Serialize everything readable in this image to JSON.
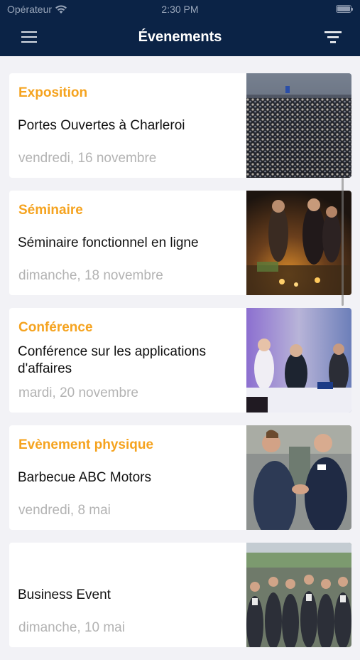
{
  "status": {
    "carrier": "Opérateur",
    "time": "2:30 PM"
  },
  "nav": {
    "title": "Évenements"
  },
  "events": [
    {
      "category": "Exposition",
      "title": "Portes Ouvertes à Charleroi",
      "date": "vendredi, 16 novembre",
      "image": "crowd-expo-photo"
    },
    {
      "category": "Séminaire",
      "title": "Séminaire fonctionnel en ligne",
      "date": "dimanche, 18 novembre",
      "image": "evening-reception-photo"
    },
    {
      "category": "Conférence",
      "title": "Conférence sur les applications d'affaires",
      "date": "mardi, 20 novembre",
      "image": "conference-table-photo"
    },
    {
      "category": "Evènement physique",
      "title": "Barbecue ABC Motors",
      "date": "vendredi, 8 mai",
      "image": "handshake-photo"
    },
    {
      "category": "",
      "title": "Business Event",
      "date": "dimanche, 10 mai",
      "image": "group-photo"
    }
  ],
  "colors": {
    "navbar": "#0b2346",
    "accent": "#f5a31f",
    "muted": "#b3b3b3",
    "background": "#f2f2f6"
  }
}
